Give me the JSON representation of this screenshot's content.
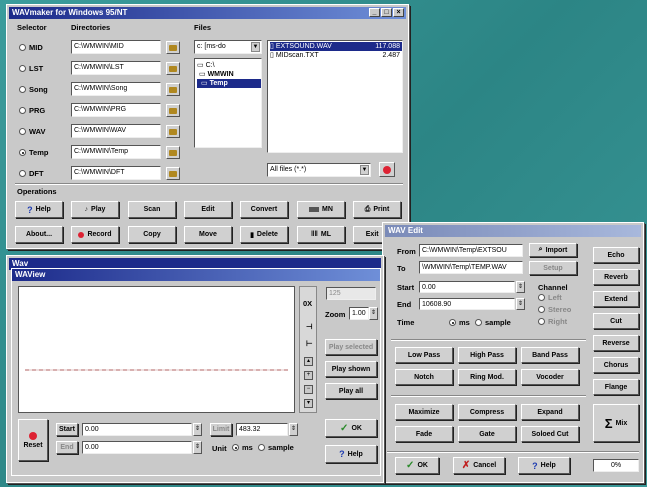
{
  "main": {
    "title": "WAVmaker for Windows 95/NT",
    "selector_header": "Selector",
    "dirs_header": "Directories",
    "files_header": "Files",
    "selectors": [
      {
        "label": "MID",
        "dir": "C:\\WMWIN\\MID",
        "checked": false
      },
      {
        "label": "LST",
        "dir": "C:\\WMWIN\\LST",
        "checked": false
      },
      {
        "label": "Song",
        "dir": "C:\\WMWIN\\Song",
        "checked": false
      },
      {
        "label": "PRG",
        "dir": "C:\\WMWIN\\PRG",
        "checked": false
      },
      {
        "label": "WAV",
        "dir": "C:\\WMWIN\\WAV",
        "checked": false
      },
      {
        "label": "Temp",
        "dir": "C:\\WMWIN\\Temp",
        "checked": true
      },
      {
        "label": "DFT",
        "dir": "C:\\WMWIN\\DFT",
        "checked": false
      }
    ],
    "drive": "c: [ms-do",
    "tree": [
      "C:\\",
      "WMWIN",
      "Temp"
    ],
    "files": [
      {
        "name": "EXTSOUND.WAV",
        "size": "117.088",
        "selected": true
      },
      {
        "name": "MIDscan.TXT",
        "size": "2.487",
        "selected": false
      }
    ],
    "filter": "All files (*.*)",
    "operations_label": "Operations",
    "ops_row1": [
      "Help",
      "Play",
      "Scan",
      "Edit",
      "Convert",
      "MN",
      "Print"
    ],
    "ops_row2": [
      "About...",
      "Record",
      "Copy",
      "Move",
      "Delete",
      "ML",
      "Exit"
    ]
  },
  "wavview": {
    "outer_title": "Wav",
    "title": "WAView",
    "zoom_label": "Zoom",
    "zoom_value": "1.00",
    "top_field": "125",
    "pct_label": "0X",
    "play_selected": "Play selected",
    "play_shown": "Play shown",
    "play_all": "Play all",
    "ok": "OK",
    "help": "Help",
    "reset": "Reset",
    "start_label": "Start",
    "start_value": "0.00",
    "limit_label": "Limit",
    "limit_value": "483.32",
    "end_label": "End",
    "end_value": "0.00",
    "unit_label": "Unit",
    "unit_ms": "ms",
    "unit_sample": "sample"
  },
  "wavedit": {
    "title": "WAV Edit",
    "from_label": "From",
    "from_value": "C:\\WMWIN\\Temp\\EXTSOU",
    "import_label": "Import",
    "to_label": "To",
    "to_value": "\\WMWIN\\Temp\\TEMP.WAV",
    "setup_label": "Setup",
    "start_label": "Start",
    "start_value": "0.00",
    "end_label": "End",
    "end_value": "10608.90",
    "time_label": "Time",
    "unit_ms": "ms",
    "unit_sample": "sample",
    "channel_label": "Channel",
    "channels": [
      "Left",
      "Stereo",
      "Right"
    ],
    "filters_row1": [
      "Low Pass",
      "High Pass",
      "Band Pass"
    ],
    "filters_row2": [
      "Notch",
      "Ring Mod.",
      "Vocoder"
    ],
    "dyn_row1": [
      "Maximize",
      "Compress",
      "Expand"
    ],
    "dyn_row2": [
      "Fade",
      "Gate",
      "Soloed Cut"
    ],
    "effects": [
      "Echo",
      "Reverb",
      "Extend",
      "Cut",
      "Reverse",
      "Chorus",
      "Flange"
    ],
    "mix_label": "Mix",
    "ok": "OK",
    "cancel": "Cancel",
    "help": "Help",
    "status_value": "0%"
  }
}
